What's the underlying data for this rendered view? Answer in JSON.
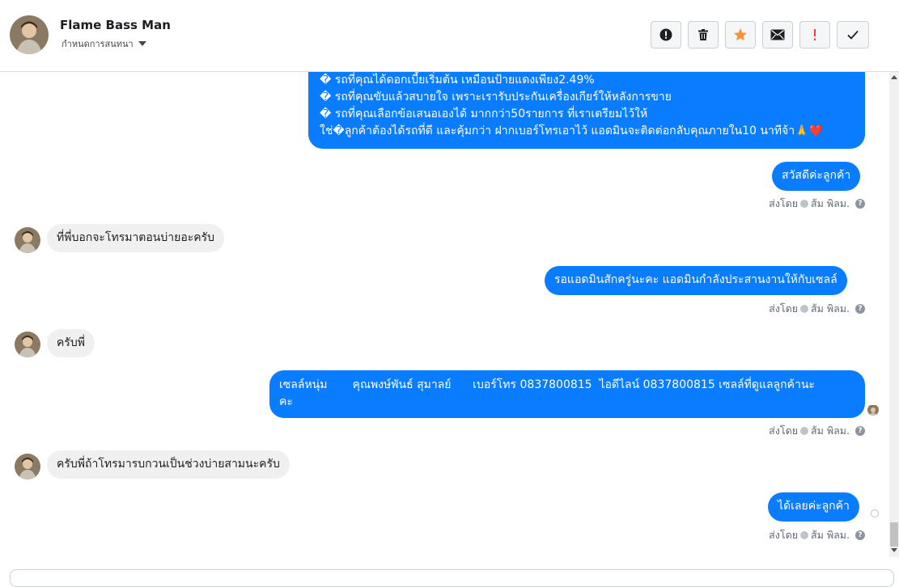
{
  "header": {
    "name": "Flame Bass Man",
    "assign_label": "กำหนดการสนทนา"
  },
  "actions": [
    {
      "icon": "alert-circle-icon",
      "name": "mark-spam-button"
    },
    {
      "icon": "trash-icon",
      "name": "delete-button"
    },
    {
      "icon": "star-icon",
      "name": "star-button"
    },
    {
      "icon": "envelope-icon",
      "name": "mark-unread-button"
    },
    {
      "icon": "exclamation-icon",
      "name": "follow-up-button"
    },
    {
      "icon": "check-icon",
      "name": "mark-done-button"
    }
  ],
  "colors": {
    "accent": "#0a7cff",
    "star": "#f7923b",
    "follow_up": "#fa383e",
    "incoming_bg": "#f0f0f0"
  },
  "messages": {
    "m1": {
      "lines": [
        "� รถที่คุณได้ดอกเบี้ยเริ่มต้น เหมือนป้ายแดงเพียง2.49%",
        "� รถที่คุณขับแล้วสบายใจ เพราะเรารับประกันเครื่องเกียร์ให้หลังการขาย",
        "� รถที่คุณเลือกข้อเสนอเองได้ มากกว่า50รายการ ที่เราเตรียมไว้ให้",
        "ใช่�ลูกค้าต้องได้รถที่ดี และคุ้มกว่า ฝากเบอร์โทรเอาไว้ แอดมินจะติดต่อกลับคุณภายใน10 นาทีจ้า🙏❤️"
      ]
    },
    "m2": {
      "text": "สวัสดีค่ะลูกค้า"
    },
    "m3": {
      "text": "ที่พี่บอกจะโทรมาตอนบ่ายอะครับ"
    },
    "m4": {
      "text": "รอแอดมินสักครู่นะคะ แอดมินกำลังประสานงานให้กับเซลล์"
    },
    "m5": {
      "text": "ครับพี่"
    },
    "m6": {
      "line1": "เซลล์หนุ่ม       คุณพงษ์พันธ์ สุมาลย์      เบอร์โทร 0837800815  ไอดีไลน์ 0837800815 เซลล์ที่ดูแลลูกค้านะ",
      "line2": "คะ"
    },
    "m7": {
      "text": "ครับพี่ถ้าโทรมารบกวนเป็นช่วงบ่ายสามนะครับ"
    },
    "m8": {
      "text": "ได้เลยค่ะลูกค้า"
    }
  },
  "sent_by": {
    "prefix": "ส่งโดย",
    "agent": "ส้ม พิลม."
  },
  "help_icon": "?"
}
